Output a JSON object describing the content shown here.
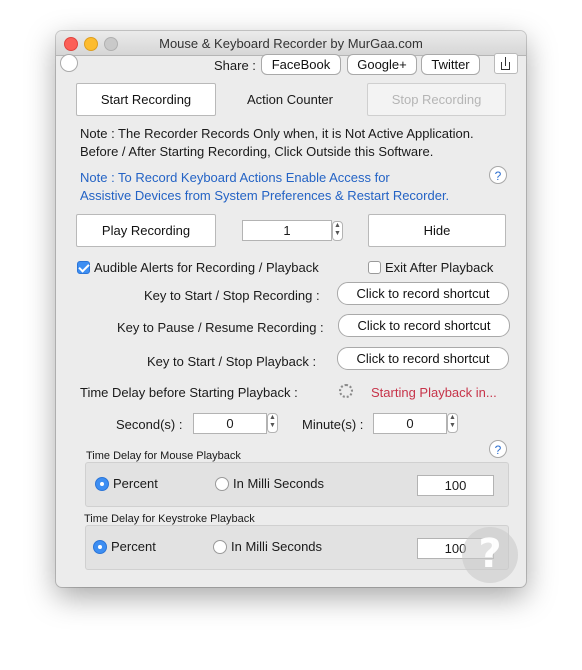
{
  "window": {
    "title": "Mouse & Keyboard Recorder by MurGaa.com"
  },
  "share": {
    "label": "Share :",
    "facebook": "FaceBook",
    "googleplus": "Google+",
    "twitter": "Twitter"
  },
  "recording": {
    "start": "Start Recording",
    "action_counter": "Action Counter",
    "stop": "Stop Recording"
  },
  "notes": {
    "line1": "Note : The Recorder Records Only when, it is Not Active Application.",
    "line2": "Before / After Starting Recording, Click Outside this Software.",
    "blue1": "Note : To Record Keyboard Actions Enable Access for",
    "blue2": "Assistive Devices from System Preferences & Restart Recorder.",
    "help": "?"
  },
  "playback": {
    "play": "Play Recording",
    "count": "1",
    "hide": "Hide"
  },
  "options": {
    "audible": "Audible Alerts for Recording / Playback",
    "audible_checked": true,
    "exit_after": "Exit After Playback",
    "exit_checked": false
  },
  "shortcuts": {
    "rows": [
      {
        "label": "Key to Start / Stop Recording :",
        "button": "Click to record shortcut"
      },
      {
        "label": "Key to Pause / Resume Recording :",
        "button": "Click to record shortcut"
      },
      {
        "label": "Key to Start / Stop Playback :",
        "button": "Click to record shortcut"
      }
    ]
  },
  "delay": {
    "label": "Time Delay before Starting Playback :",
    "status": "Starting Playback in...",
    "seconds_label": "Second(s) :",
    "seconds_value": "0",
    "minutes_label": "Minute(s) :",
    "minutes_value": "0",
    "help": "?"
  },
  "mouse_delay": {
    "title": "Time Delay for Mouse Playback",
    "percent": "Percent",
    "milli": "In Milli Seconds",
    "value": "100",
    "selected": "percent"
  },
  "key_delay": {
    "title": "Time Delay for Keystroke Playback",
    "percent": "Percent",
    "milli": "In Milli Seconds",
    "value": "100",
    "selected": "percent"
  },
  "colors": {
    "accent": "#3d8ef2",
    "note_blue": "#2463c5",
    "status_red": "#c7344a"
  }
}
